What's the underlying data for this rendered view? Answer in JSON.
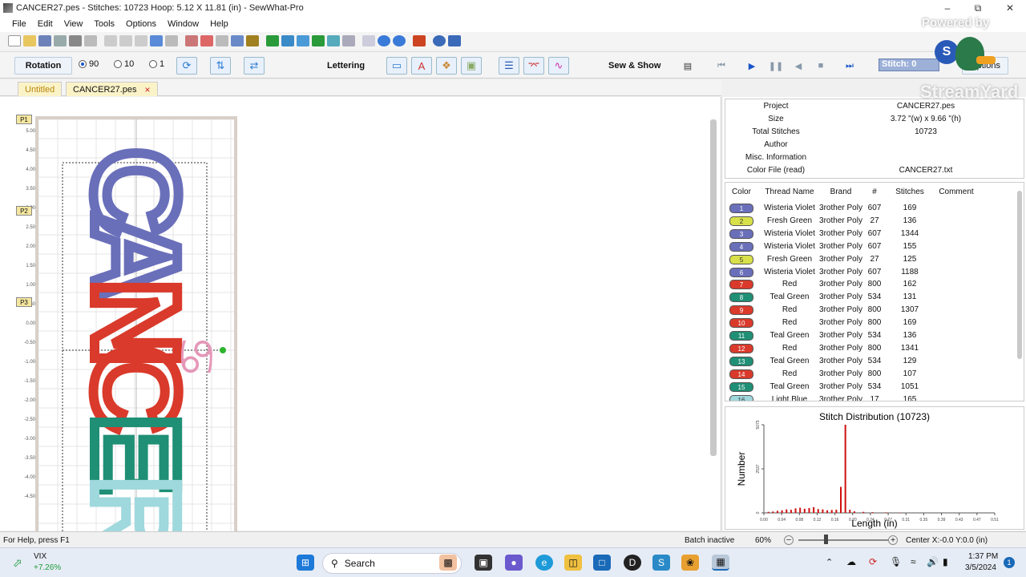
{
  "window": {
    "title": "CANCER27.pes - Stitches: 10723  Hoop: 5.12 X 11.81 (in) - SewWhat-Pro"
  },
  "menu": [
    "File",
    "Edit",
    "View",
    "Tools",
    "Options",
    "Window",
    "Help"
  ],
  "toolbar2": {
    "rotation_label": "Rotation",
    "rot_90": "90",
    "rot_10": "10",
    "rot_1": "1",
    "lettering_label": "Lettering",
    "sewshow_label": "Sew & Show",
    "stitch_label": "Stitch: 0",
    "options_label": "Options"
  },
  "tabs": [
    {
      "label": "Untitled",
      "active": false
    },
    {
      "label": "CANCER27.pes",
      "active": true,
      "close": "×"
    }
  ],
  "ruler": {
    "ticks": [
      "5.00",
      "4.50",
      "4.00",
      "3.50",
      "3.00",
      "2.50",
      "2.00",
      "1.50",
      "1.00",
      "0.50",
      "0.00",
      "-0.50",
      "-1.00",
      "-1.50",
      "-2.00",
      "-2.50",
      "-3.00",
      "-3.50",
      "-4.00",
      "-4.50"
    ]
  },
  "placement_flags": [
    "P1",
    "P2",
    "P3"
  ],
  "design": {
    "letters": [
      {
        "char": "C",
        "color": "#6a6fba"
      },
      {
        "char": "A",
        "color": "#6a6fba"
      },
      {
        "char": "N",
        "color": "#d93a2b"
      },
      {
        "char": "C",
        "color": "#d93a2b"
      },
      {
        "char": "E",
        "color": "#1f8f75"
      },
      {
        "char": "R",
        "color": "#9fd8dd"
      }
    ],
    "symbol": "♋",
    "symbol_color": "#e598b8"
  },
  "properties": [
    {
      "key": "Project",
      "value": "CANCER27.pes"
    },
    {
      "key": "Size",
      "value": "3.72 \"(w) x 9.66 \"(h)"
    },
    {
      "key": "Total Stitches",
      "value": "10723"
    },
    {
      "key": "Author",
      "value": ""
    },
    {
      "key": "Misc. Information",
      "value": ""
    },
    {
      "key": "Color File (read)",
      "value": "CANCER27.txt"
    }
  ],
  "color_table": {
    "headers": [
      "Color",
      "Thread Name",
      "Brand",
      "#",
      "Stitches",
      "Comment"
    ],
    "rows": [
      {
        "n": "1",
        "hex": "#6a6fba",
        "name": "Wisteria Violet",
        "brand": "3rother Poly",
        "num": "607",
        "stitches": "169"
      },
      {
        "n": "2",
        "hex": "#d8e04a",
        "name": "Fresh Green",
        "brand": "3rother Poly",
        "num": "27",
        "stitches": "136"
      },
      {
        "n": "3",
        "hex": "#6a6fba",
        "name": "Wisteria Violet",
        "brand": "3rother Poly",
        "num": "607",
        "stitches": "1344"
      },
      {
        "n": "4",
        "hex": "#6a6fba",
        "name": "Wisteria Violet",
        "brand": "3rother Poly",
        "num": "607",
        "stitches": "155"
      },
      {
        "n": "5",
        "hex": "#d8e04a",
        "name": "Fresh Green",
        "brand": "3rother Poly",
        "num": "27",
        "stitches": "125"
      },
      {
        "n": "6",
        "hex": "#6a6fba",
        "name": "Wisteria Violet",
        "brand": "3rother Poly",
        "num": "607",
        "stitches": "1188"
      },
      {
        "n": "7",
        "hex": "#d93a2b",
        "name": "Red",
        "brand": "3rother Poly",
        "num": "800",
        "stitches": "162"
      },
      {
        "n": "8",
        "hex": "#1f8f75",
        "name": "Teal Green",
        "brand": "3rother Poly",
        "num": "534",
        "stitches": "131"
      },
      {
        "n": "9",
        "hex": "#d93a2b",
        "name": "Red",
        "brand": "3rother Poly",
        "num": "800",
        "stitches": "1307"
      },
      {
        "n": "10",
        "hex": "#d93a2b",
        "name": "Red",
        "brand": "3rother Poly",
        "num": "800",
        "stitches": "169"
      },
      {
        "n": "11",
        "hex": "#1f8f75",
        "name": "Teal Green",
        "brand": "3rother Poly",
        "num": "534",
        "stitches": "136"
      },
      {
        "n": "12",
        "hex": "#d93a2b",
        "name": "Red",
        "brand": "3rother Poly",
        "num": "800",
        "stitches": "1341"
      },
      {
        "n": "13",
        "hex": "#1f8f75",
        "name": "Teal Green",
        "brand": "3rother Poly",
        "num": "534",
        "stitches": "129"
      },
      {
        "n": "14",
        "hex": "#d93a2b",
        "name": "Red",
        "brand": "3rother Poly",
        "num": "800",
        "stitches": "107"
      },
      {
        "n": "15",
        "hex": "#1f8f75",
        "name": "Teal Green",
        "brand": "3rother Poly",
        "num": "534",
        "stitches": "1051"
      },
      {
        "n": "16",
        "hex": "#9fd8dd",
        "name": "Light Blue",
        "brand": "3rother Poly",
        "num": "17",
        "stitches": "165"
      }
    ]
  },
  "chart_data": {
    "type": "bar",
    "title": "Stitch Distribution (10723)",
    "xlabel": "Length (in)",
    "ylabel": "Number",
    "xlim": [
      0,
      0.51
    ],
    "ylim": [
      0,
      5075
    ],
    "x_ticks": [
      "0.00",
      "0.04",
      "0.08",
      "0.12",
      "0.16",
      "0.20",
      "0.24",
      "0.27",
      "0.31",
      "0.35",
      "0.39",
      "0.43",
      "0.47",
      "0.51"
    ],
    "y_ticks": [
      "0",
      "2537",
      "5075"
    ],
    "color": "#d01010",
    "x": [
      0.01,
      0.02,
      0.03,
      0.04,
      0.05,
      0.06,
      0.07,
      0.08,
      0.09,
      0.1,
      0.11,
      0.12,
      0.13,
      0.14,
      0.15,
      0.16,
      0.17,
      0.18,
      0.19,
      0.2,
      0.22,
      0.24,
      0.27,
      0.3
    ],
    "values": [
      60,
      80,
      120,
      150,
      200,
      180,
      260,
      300,
      240,
      280,
      330,
      220,
      200,
      150,
      170,
      180,
      1500,
      5075,
      180,
      90,
      60,
      40,
      30,
      20
    ]
  },
  "status": {
    "help": "For Help, press F1",
    "batch": "Batch inactive",
    "zoom": "60%",
    "center": "Center X:-0.0  Y:0.0 (in)"
  },
  "taskbar": {
    "ticker_name": "VIX",
    "ticker_change": "+7.26%",
    "search_placeholder": "Search",
    "time": "1:37 PM",
    "date": "3/5/2024",
    "notif_count": "1"
  },
  "watermark": {
    "powered": "Powered by",
    "brand": "StreamYard"
  }
}
